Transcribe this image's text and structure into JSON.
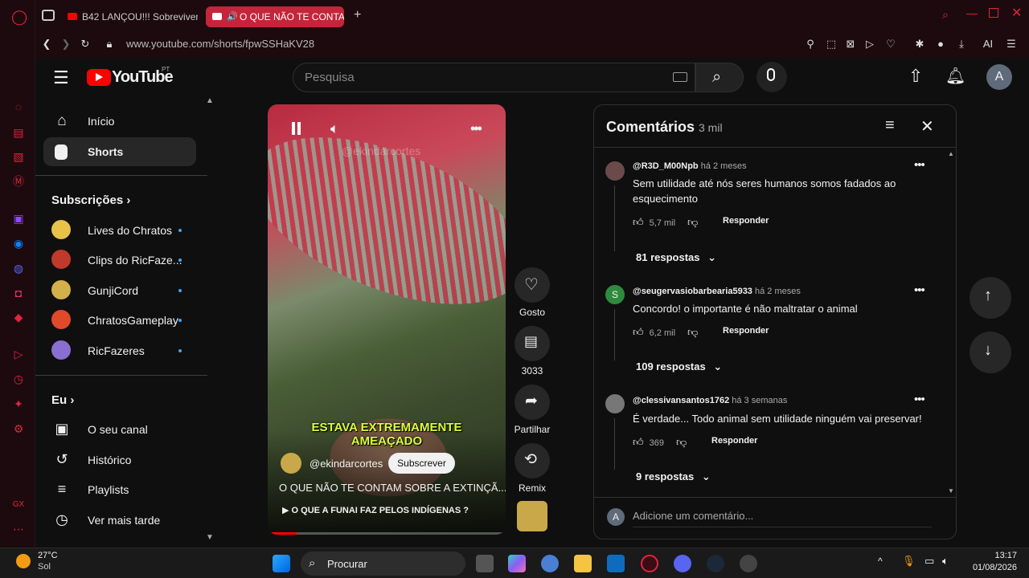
{
  "browser": {
    "tabs": [
      {
        "label": "B42 LANÇOU!!! Sobreviven",
        "active": false
      },
      {
        "label": "O QUE NÃO TE CONTA",
        "active": true
      }
    ],
    "url": "www.youtube.com/shorts/fpwSSHaKV28",
    "ai_label": "AI"
  },
  "youtube": {
    "logo_text": "YouTube",
    "logo_region": "PT",
    "search_placeholder": "Pesquisa",
    "account_initial": "A"
  },
  "sidebar": {
    "main": [
      {
        "label": "Início",
        "icon": "home-icon"
      },
      {
        "label": "Shorts",
        "icon": "shorts-icon",
        "active": true
      }
    ],
    "subs_title": "Subscrições",
    "subs": [
      {
        "label": "Lives do Chratos",
        "color": "#e8c34a"
      },
      {
        "label": "Clips do RicFaze...",
        "color": "#c0392b"
      },
      {
        "label": "GunjiCord",
        "color": "#d4b04a"
      },
      {
        "label": "ChratosGameplay",
        "color": "#e04a2a"
      },
      {
        "label": "RicFazeres",
        "color": "#8a6fd0"
      }
    ],
    "you_title": "Eu",
    "you": [
      {
        "label": "O seu canal",
        "icon": "channel-icon"
      },
      {
        "label": "Histórico",
        "icon": "history-icon"
      },
      {
        "label": "Playlists",
        "icon": "playlists-icon"
      },
      {
        "label": "Ver mais tarde",
        "icon": "watch-later-icon"
      }
    ]
  },
  "short": {
    "watermark": "@ekindarcortes",
    "caption": "ESTAVA EXTREMAMENTE AMEAÇADO",
    "channel": "@ekindarcortes",
    "subscribe_label": "Subscrever",
    "title": "O QUE NÃO TE CONTAM SOBRE A EXTINÇÃ...",
    "related": "O QUE A FUNAI FAZ PELOS INDÍGENAS ?",
    "actions": [
      {
        "label": "Gosto",
        "icon": "heart-icon"
      },
      {
        "label": "3033",
        "icon": "comment-icon"
      },
      {
        "label": "Partilhar",
        "icon": "share-icon"
      },
      {
        "label": "Remix",
        "icon": "remix-icon"
      }
    ]
  },
  "comments": {
    "title": "Comentários",
    "count": "3 mil",
    "items": [
      {
        "author": "@R3D_M00Npb",
        "time": "há 2 meses",
        "text": "Sem utilidade até nós seres humanos somos fadados ao esquecimento",
        "likes": "5,7 mil",
        "reply_label": "Responder",
        "replies": "81 respostas",
        "avatar_color": "#6a4a4a",
        "avatar_letter": ""
      },
      {
        "author": "@seugervasiobarbearia5933",
        "time": "há 2 meses",
        "text": "Concordo! o importante é não maltratar o animal",
        "likes": "6,2 mil",
        "reply_label": "Responder",
        "replies": "109 respostas",
        "avatar_color": "#2e8b3e",
        "avatar_letter": "S"
      },
      {
        "author": "@clessivansantos1762",
        "time": "há 3 semanas",
        "text": "É verdade... Todo animal sem utilidade ninguém vai preservar!",
        "likes": "369",
        "reply_label": "Responder",
        "replies": "9 respostas",
        "avatar_color": "#777777",
        "avatar_letter": ""
      }
    ],
    "add_placeholder": "Adicione um comentário...",
    "user_initial": "A"
  },
  "taskbar": {
    "weather_temp": "27°C",
    "weather_desc": "Sol",
    "search_label": "Procurar",
    "time": "13:17",
    "date": "01/08/2026"
  }
}
